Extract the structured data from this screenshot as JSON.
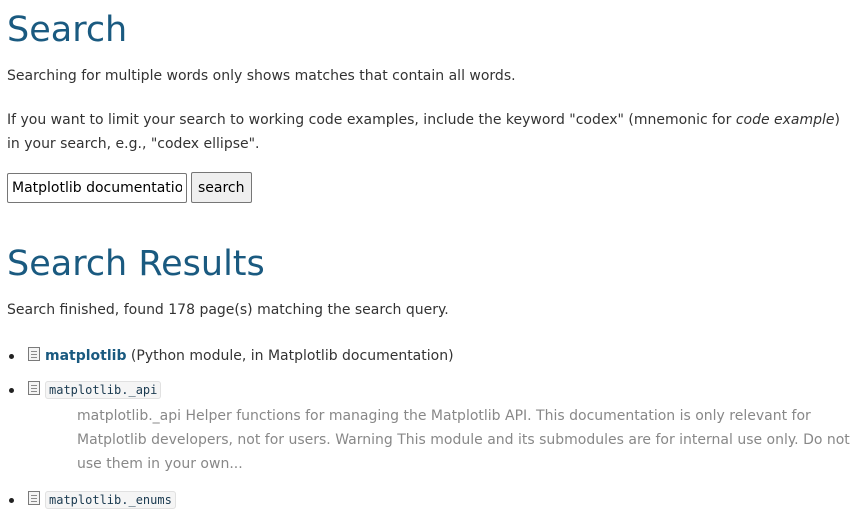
{
  "page": {
    "title": "Search",
    "intro": "Searching for multiple words only shows matches that contain all words.",
    "tip": {
      "before": "If you want to limit your search to working code examples, include the keyword \"codex\" (mnemonic for ",
      "emphasis": "code example",
      "after": ") in your search, e.g., \"codex ellipse\"."
    }
  },
  "search": {
    "value": "Matplotlib documentation",
    "button_label": "search"
  },
  "results": {
    "heading": "Search Results",
    "status": "Search finished, found 178 page(s) matching the search query.",
    "items": [
      {
        "link": "matplotlib",
        "context": " (Python module, in Matplotlib documentation)"
      },
      {
        "code": "matplotlib._api",
        "excerpt": "matplotlib._api Helper functions for managing the Matplotlib API. This documentation is only relevant for Matplotlib developers, not for users. Warning This module and its submodules are for internal use only. Do not use them in your own..."
      },
      {
        "code": "matplotlib._enums"
      }
    ]
  },
  "icons": {
    "result": "document-icon"
  },
  "colors": {
    "heading": "#1a5a80",
    "link": "#1a5a80",
    "excerpt": "#888888"
  }
}
